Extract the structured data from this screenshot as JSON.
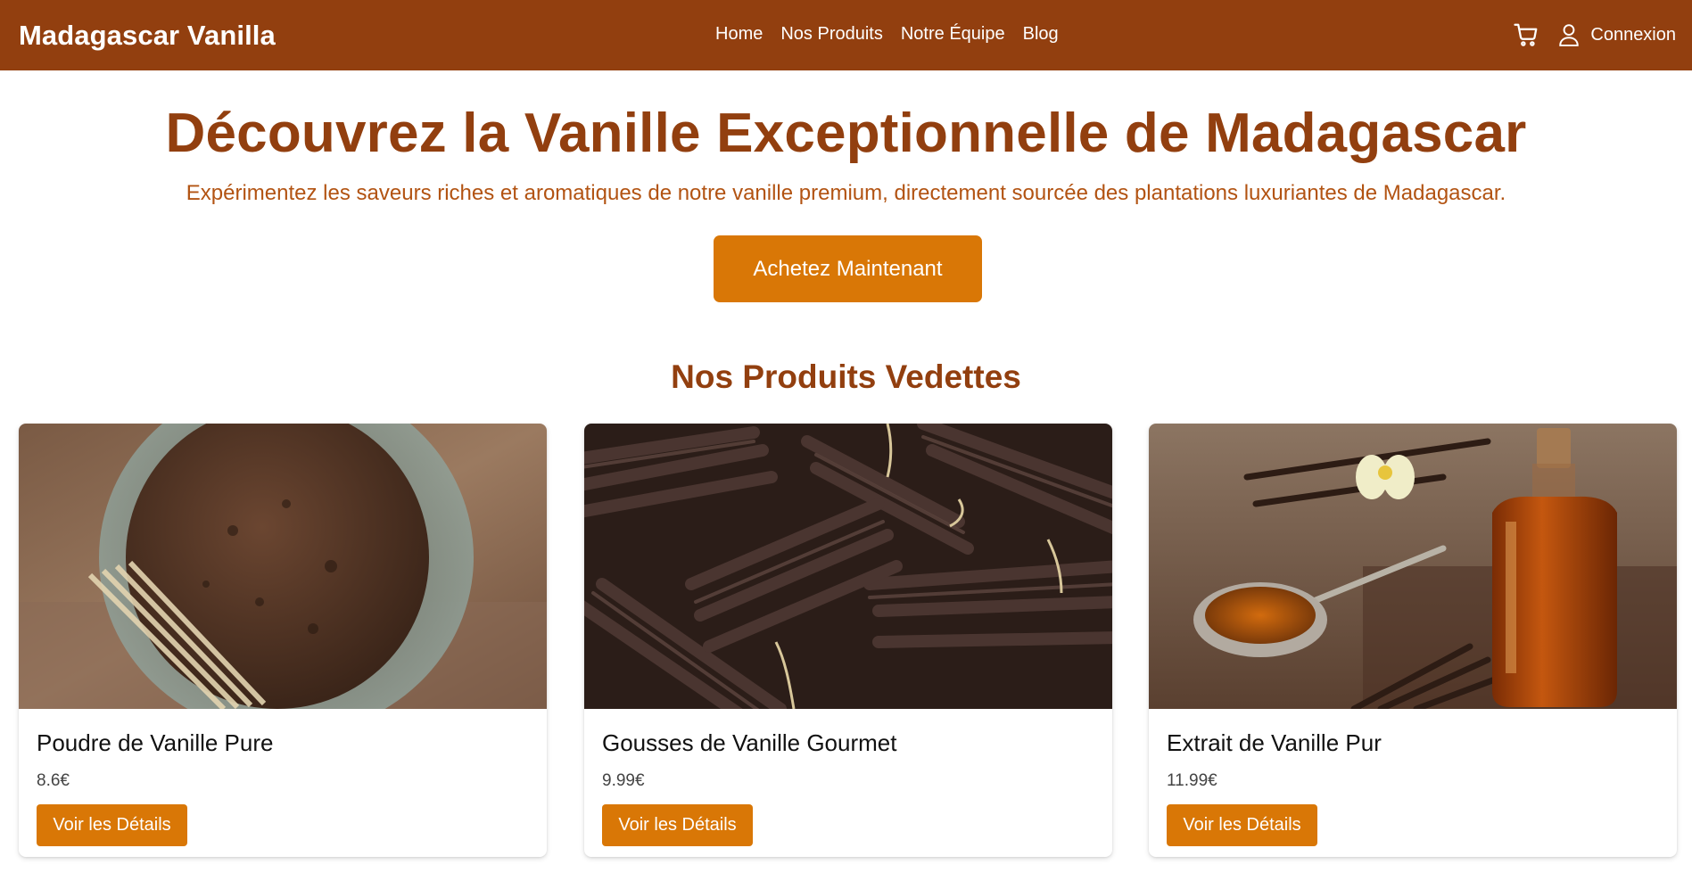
{
  "header": {
    "brand": "Madagascar Vanilla",
    "nav": [
      "Home",
      "Nos Produits",
      "Notre Équipe",
      "Blog"
    ],
    "login_label": "Connexion",
    "icons": {
      "cart": "cart-icon",
      "user": "user-icon"
    }
  },
  "hero": {
    "title": "Découvrez la Vanille Exceptionnelle de Madagascar",
    "subtitle": "Expérimentez les saveurs riches et aromatiques de notre vanille premium, directement sourcée des plantations luxuriantes de Madagascar.",
    "cta_label": "Achetez Maintenant"
  },
  "featured": {
    "title": "Nos Produits Vedettes",
    "products": [
      {
        "name": "Poudre de Vanille Pure",
        "price": "8.6€",
        "button": "Voir les Détails"
      },
      {
        "name": "Gousses de Vanille Gourmet",
        "price": "9.99€",
        "button": "Voir les Détails"
      },
      {
        "name": "Extrait de Vanille Pur",
        "price": "11.99€",
        "button": "Voir les Détails"
      }
    ]
  },
  "colors": {
    "header_bg": "#923f0f",
    "accent": "#d97706",
    "title": "#923f0f",
    "subtitle": "#b25312"
  }
}
